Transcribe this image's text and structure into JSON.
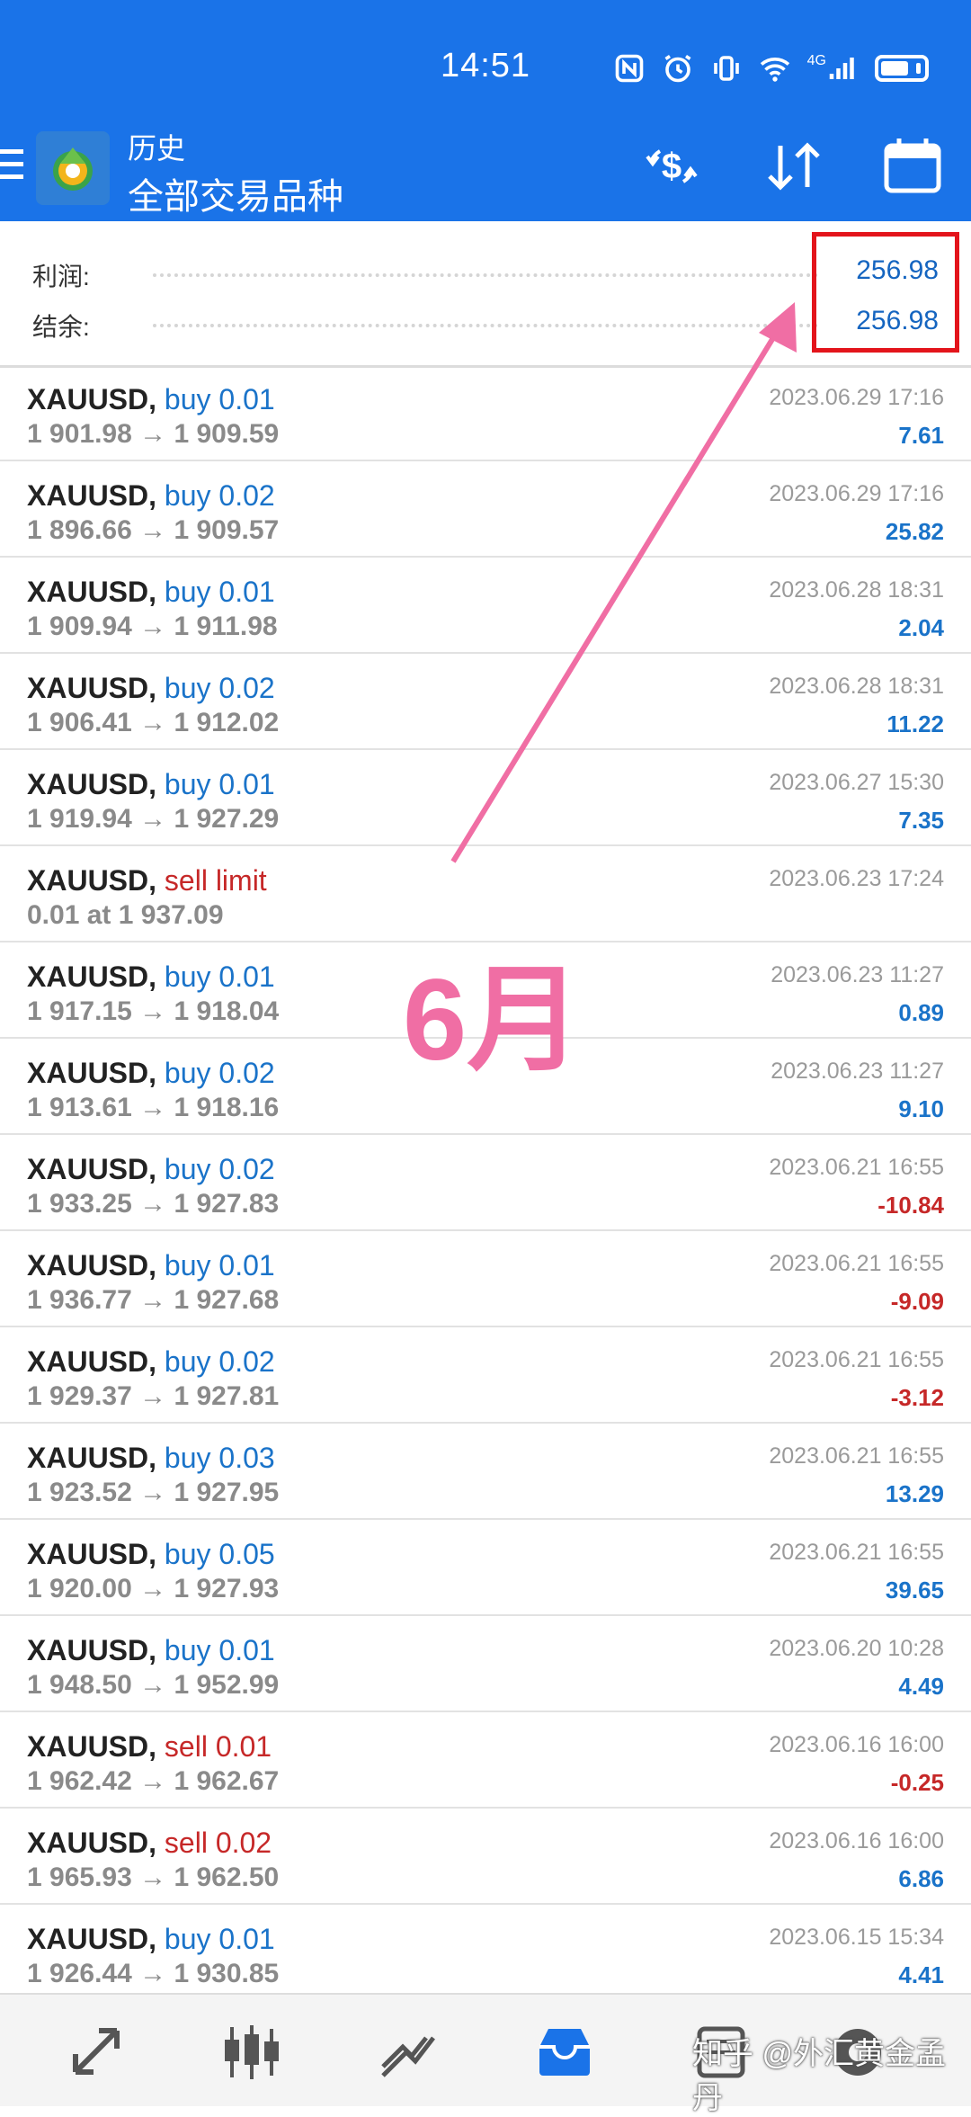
{
  "status_bar": {
    "time": "14:51",
    "network": "4G",
    "icons": [
      "nfc-icon",
      "alarm-icon",
      "vibrate-icon",
      "wifi-icon",
      "signal-icon",
      "battery-icon"
    ]
  },
  "header": {
    "title": "历史",
    "subtitle": "全部交易品种",
    "actions": [
      "deposit-icon",
      "sort-icon",
      "calendar-icon"
    ]
  },
  "summary": {
    "profit_label": "利润:",
    "profit_value": "256.98",
    "balance_label": "结余:",
    "balance_value": "256.98"
  },
  "deals": [
    {
      "symbol": "XAUUSD,",
      "action": "buy 0.01",
      "side": "buy",
      "prices": "1 901.98 → 1 909.59",
      "time": "2023.06.29 17:16",
      "profit": "7.61"
    },
    {
      "symbol": "XAUUSD,",
      "action": "buy 0.02",
      "side": "buy",
      "prices": "1 896.66 → 1 909.57",
      "time": "2023.06.29 17:16",
      "profit": "25.82"
    },
    {
      "symbol": "XAUUSD,",
      "action": "buy 0.01",
      "side": "buy",
      "prices": "1 909.94 → 1 911.98",
      "time": "2023.06.28 18:31",
      "profit": "2.04"
    },
    {
      "symbol": "XAUUSD,",
      "action": "buy 0.02",
      "side": "buy",
      "prices": "1 906.41 → 1 912.02",
      "time": "2023.06.28 18:31",
      "profit": "11.22"
    },
    {
      "symbol": "XAUUSD,",
      "action": "buy 0.01",
      "side": "buy",
      "prices": "1 919.94 → 1 927.29",
      "time": "2023.06.27 15:30",
      "profit": "7.35"
    },
    {
      "symbol": "XAUUSD,",
      "action": "sell limit",
      "side": "sell",
      "prices": "0.01 at 1 937.09",
      "time": "2023.06.23 17:24",
      "profit": ""
    },
    {
      "symbol": "XAUUSD,",
      "action": "buy 0.01",
      "side": "buy",
      "prices": "1 917.15 → 1 918.04",
      "time": "2023.06.23 11:27",
      "profit": "0.89"
    },
    {
      "symbol": "XAUUSD,",
      "action": "buy 0.02",
      "side": "buy",
      "prices": "1 913.61 → 1 918.16",
      "time": "2023.06.23 11:27",
      "profit": "9.10"
    },
    {
      "symbol": "XAUUSD,",
      "action": "buy 0.02",
      "side": "buy",
      "prices": "1 933.25 → 1 927.83",
      "time": "2023.06.21 16:55",
      "profit": "-10.84"
    },
    {
      "symbol": "XAUUSD,",
      "action": "buy 0.01",
      "side": "buy",
      "prices": "1 936.77 → 1 927.68",
      "time": "2023.06.21 16:55",
      "profit": "-9.09"
    },
    {
      "symbol": "XAUUSD,",
      "action": "buy 0.02",
      "side": "buy",
      "prices": "1 929.37 → 1 927.81",
      "time": "2023.06.21 16:55",
      "profit": "-3.12"
    },
    {
      "symbol": "XAUUSD,",
      "action": "buy 0.03",
      "side": "buy",
      "prices": "1 923.52 → 1 927.95",
      "time": "2023.06.21 16:55",
      "profit": "13.29"
    },
    {
      "symbol": "XAUUSD,",
      "action": "buy 0.05",
      "side": "buy",
      "prices": "1 920.00 → 1 927.93",
      "time": "2023.06.21 16:55",
      "profit": "39.65"
    },
    {
      "symbol": "XAUUSD,",
      "action": "buy 0.01",
      "side": "buy",
      "prices": "1 948.50 → 1 952.99",
      "time": "2023.06.20 10:28",
      "profit": "4.49"
    },
    {
      "symbol": "XAUUSD,",
      "action": "sell 0.01",
      "side": "sell",
      "prices": "1 962.42 → 1 962.67",
      "time": "2023.06.16 16:00",
      "profit": "-0.25"
    },
    {
      "symbol": "XAUUSD,",
      "action": "sell 0.02",
      "side": "sell",
      "prices": "1 965.93 → 1 962.50",
      "time": "2023.06.16 16:00",
      "profit": "6.86"
    },
    {
      "symbol": "XAUUSD,",
      "action": "buy 0.01",
      "side": "buy",
      "prices": "1 926.44 → 1 930.85",
      "time": "2023.06.15 15:34",
      "profit": "4.41"
    }
  ],
  "annotation": {
    "text": "6月",
    "color": "#f06ea4",
    "highlight_color": "#e3141b"
  },
  "bottom_nav": {
    "items": [
      "quotes-icon",
      "chart-icon",
      "trade-icon",
      "history-icon",
      "messages-icon",
      "settings-icon"
    ],
    "active": "history-icon"
  },
  "watermark": "知乎 @外汇黄金孟丹",
  "colors": {
    "header_bg": "#1a73e8",
    "positive": "#1a73c9",
    "negative": "#c62828"
  }
}
